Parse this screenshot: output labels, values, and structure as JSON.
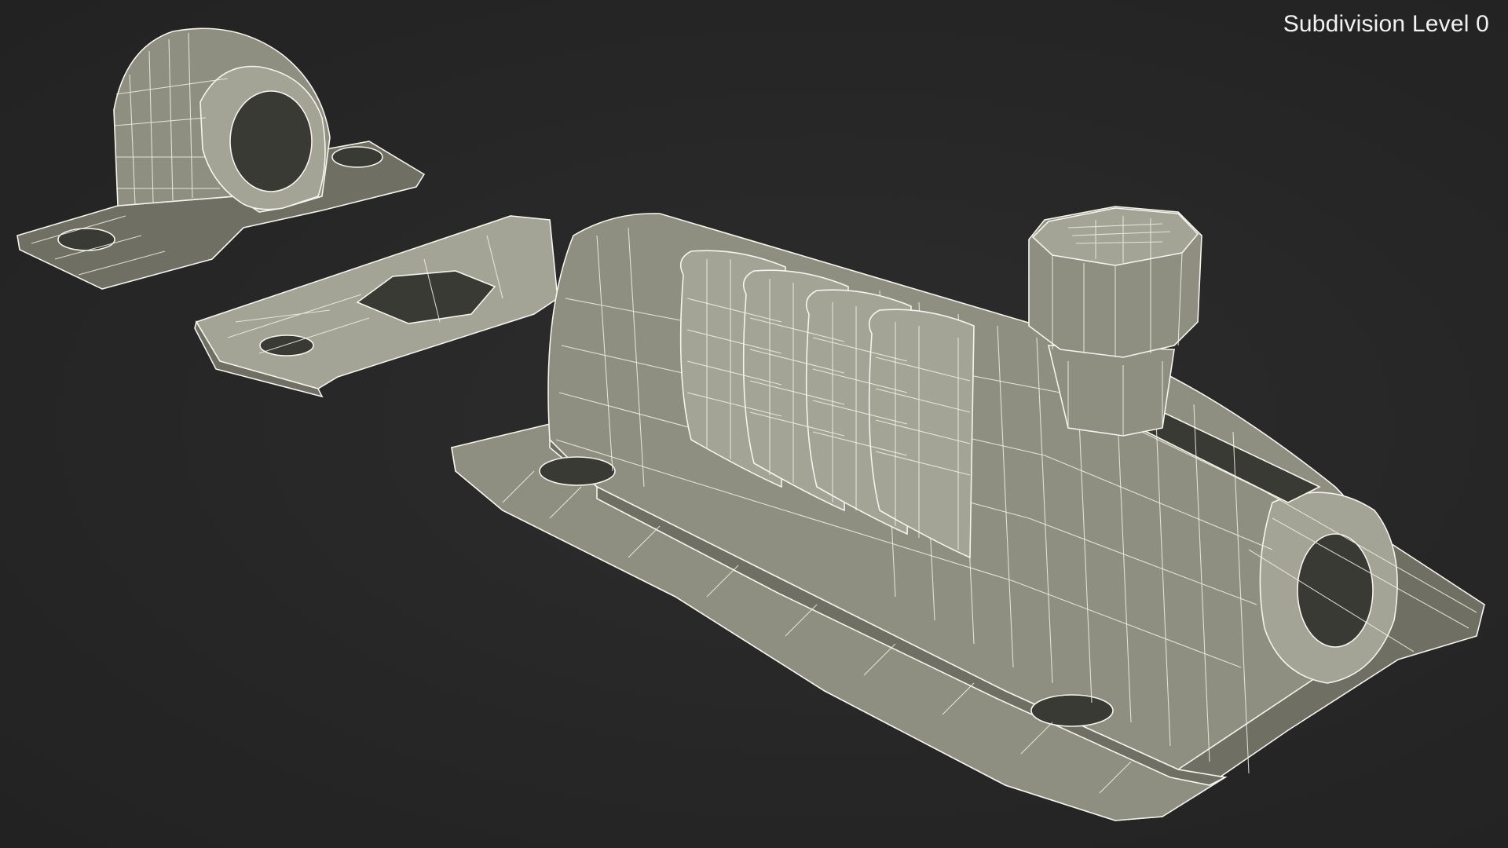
{
  "viewport": {
    "title": "Subdivision Level 0",
    "background_color": "#272727",
    "mesh_color": "#8f8f81",
    "wire_color": "#f4f4ee"
  },
  "objects": [
    {
      "name": "Keeper Staple"
    },
    {
      "name": "Bolt Body"
    },
    {
      "name": "Combination Dials"
    },
    {
      "name": "Bolt Knob"
    }
  ]
}
